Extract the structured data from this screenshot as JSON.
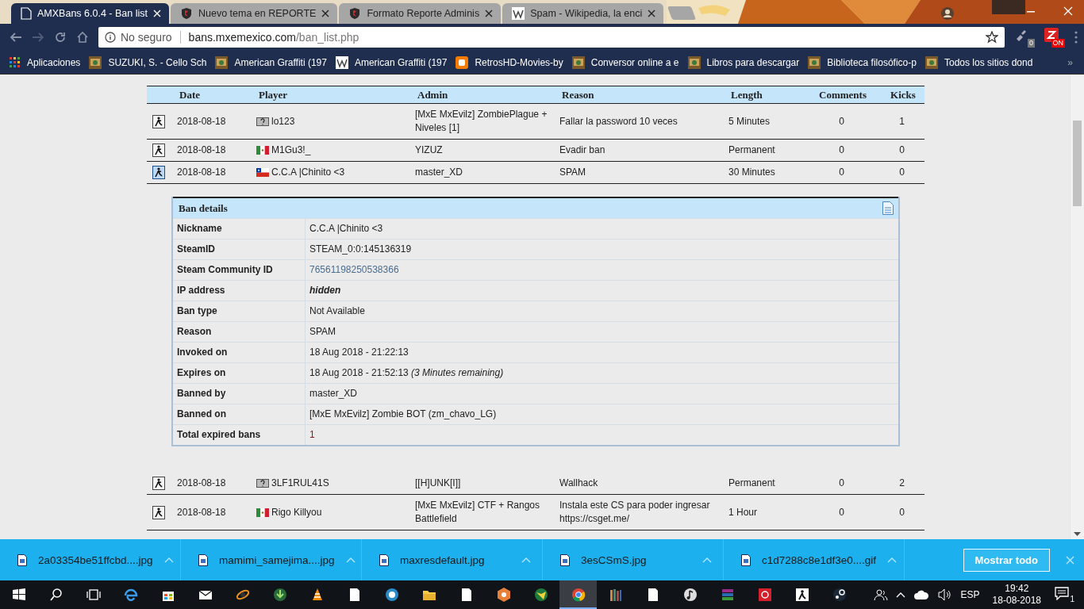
{
  "browser": {
    "tabs": [
      {
        "title": "AMXBans 6.0.4 - Ban list",
        "kind": "page",
        "selected": true
      },
      {
        "title": "Nuevo tema en REPORTE",
        "kind": "shield",
        "selected": false
      },
      {
        "title": "Formato Reporte Adminis",
        "kind": "shield",
        "selected": false
      },
      {
        "title": "Spam - Wikipedia, la enci",
        "kind": "tile",
        "selected": false
      }
    ],
    "forward_disabled": true,
    "address": {
      "security": "No seguro",
      "host": "bans.mxemexico.com",
      "path": "/ban_list.php"
    },
    "extension_badges": [
      "0",
      "ON"
    ],
    "bookmarks": [
      {
        "label": "Aplicaciones",
        "kind": "apps"
      },
      {
        "label": "SUZUKI, S. - Cello Sch",
        "kind": "thumb"
      },
      {
        "label": "American Graffiti (197",
        "kind": "thumb"
      },
      {
        "label": "American Graffiti (197",
        "kind": "tile"
      },
      {
        "label": "RetrosHD-Movies-by",
        "kind": "blog"
      },
      {
        "label": "Conversor online a e",
        "kind": "thumb"
      },
      {
        "label": "Libros para descargar",
        "kind": "thumb"
      },
      {
        "label": "Biblioteca filosófico-p",
        "kind": "thumb"
      },
      {
        "label": "Todos los sitios dond",
        "kind": "thumb"
      }
    ],
    "bookmarks_more": "»"
  },
  "table": {
    "columns": [
      "Date",
      "Player",
      "Admin",
      "Reason",
      "Length",
      "Comments",
      "Kicks"
    ],
    "rows": [
      {
        "date": "2018-08-18",
        "kind": "unknown",
        "player": "lo123",
        "admin": "[MxE MxEvilz] ZombiePlague + Niveles [1]",
        "reason": "Fallar la password 10 veces",
        "length": "5 Minutes",
        "comments": "0",
        "kicks": "1",
        "expanded": false
      },
      {
        "date": "2018-08-18",
        "kind": "mexico",
        "player": "M1Gu3!_",
        "admin": "YIZUZ",
        "reason": "Evadir ban",
        "length": "Permanent",
        "comments": "0",
        "kicks": "0",
        "expanded": false
      },
      {
        "date": "2018-08-18",
        "kind": "chile",
        "player": "C.C.A |Chinito <3",
        "admin": "master_XD",
        "reason": "SPAM",
        "length": "30 Minutes",
        "comments": "0",
        "kicks": "0",
        "expanded": true
      },
      {
        "date": "2018-08-18",
        "kind": "unknown",
        "player": "3LF1RUL41S",
        "admin": "[[H]UNK[I]]",
        "reason": "Wallhack",
        "length": "Permanent",
        "comments": "0",
        "kicks": "2",
        "expanded": false
      },
      {
        "date": "2018-08-18",
        "kind": "mexico",
        "player": "Rigo Killyou",
        "admin": "[MxE MxEvilz] CTF + Rangos Battlefield",
        "reason": "Instala este CS para poder ingresar https://csget.me/",
        "length": "1 Hour",
        "comments": "0",
        "kicks": "0",
        "expanded": false
      }
    ]
  },
  "ban_details": {
    "title": "Ban details",
    "fields": [
      {
        "label": "Nickname",
        "value": "C.C.A |Chinito <3",
        "kind": "text"
      },
      {
        "label": "SteamID",
        "value": "STEAM_0:0:145136319",
        "kind": "text"
      },
      {
        "label": "Steam Community ID",
        "value": "76561198250538366",
        "kind": "link"
      },
      {
        "label": "IP address",
        "value": "hidden",
        "kind": "emphasis"
      },
      {
        "label": "Ban type",
        "value": "Not Available",
        "kind": "text"
      },
      {
        "label": "Reason",
        "value": "SPAM",
        "kind": "text"
      },
      {
        "label": "Invoked on",
        "value": "18 Aug 2018 - 21:22:13",
        "kind": "text"
      },
      {
        "label": "Expires on",
        "value": "18 Aug 2018 - 21:52:13 *(3 Minutes remaining)*",
        "kind": "text"
      },
      {
        "label": "Banned by",
        "value": "master_XD",
        "kind": "text"
      },
      {
        "label": "Banned on",
        "value": "[MxE MxEvilz] Zombie BOT (zm_chavo_LG)",
        "kind": "text"
      },
      {
        "label": "Total expired bans",
        "value": "1",
        "kind": "count"
      }
    ]
  },
  "downloads": {
    "items": [
      "2a03354be51ffcbd....jpg",
      "mamimi_samejima....jpg",
      "maxresdefault.jpg",
      "3esCSmS.jpg",
      "c1d7288c8e1df3e0....gif"
    ],
    "show_all": "Mostrar todo"
  },
  "taskbar": {
    "language": "ESP",
    "time": "19:42",
    "date": "18-08-2018",
    "notifications": "1"
  }
}
